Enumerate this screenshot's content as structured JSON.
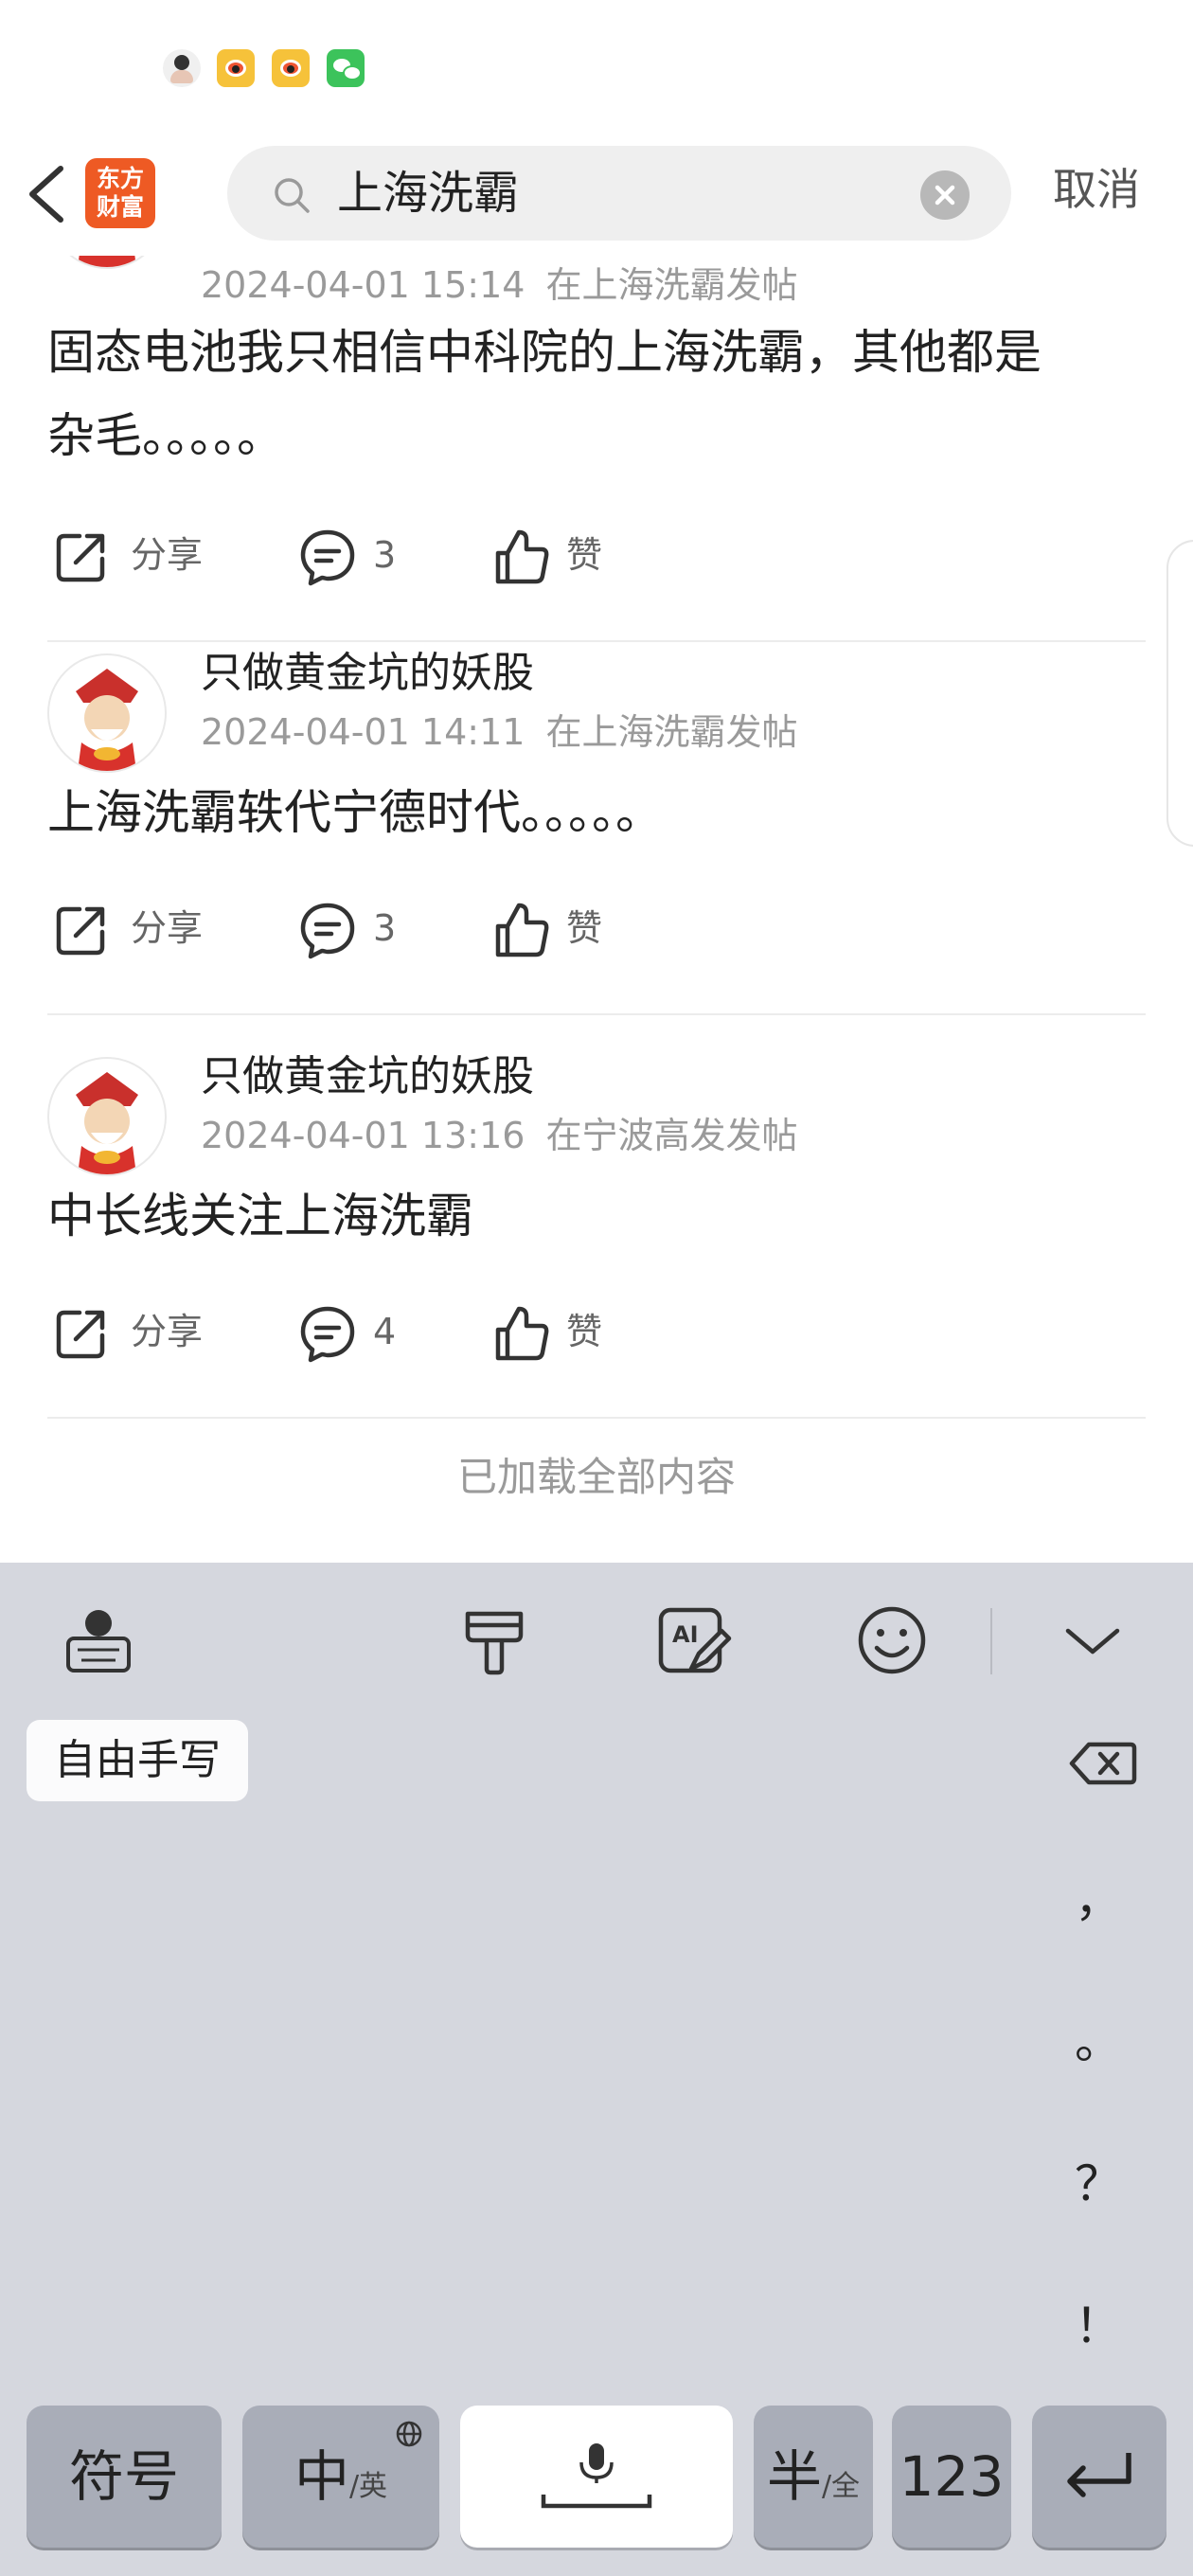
{
  "search": {
    "query": "上海洗霸",
    "cancel_label": "取消",
    "logo_line1": "东方",
    "logo_line2": "财富"
  },
  "posts": [
    {
      "author": "",
      "date": "2024-04-01 15:14",
      "location": "在上海洗霸发帖",
      "content_line1": "固态电池我只相信中科院的上海洗霸，其他都是",
      "content_line2": "杂毛。。。。。",
      "share_label": "分享",
      "comment_count": "3",
      "like_label": "赞"
    },
    {
      "author": "只做黄金坑的妖股",
      "date": "2024-04-01 14:11",
      "location": "在上海洗霸发帖",
      "content_line1": "上海洗霸轶代宁德时代。。。。。",
      "share_label": "分享",
      "comment_count": "3",
      "like_label": "赞"
    },
    {
      "author": "只做黄金坑的妖股",
      "date": "2024-04-01 13:16",
      "location": "在宁波高发发帖",
      "content_line1": "中长线关注上海洗霸",
      "share_label": "分享",
      "comment_count": "4",
      "like_label": "赞"
    }
  ],
  "feed_footer": "已加载全部内容",
  "keyboard": {
    "freewrite_label": "自由手写",
    "punctuation": [
      "，",
      "。",
      "？",
      "！"
    ],
    "keys": {
      "symbols": "符号",
      "chinese_main": "中",
      "chinese_sub": "/英",
      "half_main": "半",
      "half_sub": "/全",
      "numbers": "123"
    }
  }
}
